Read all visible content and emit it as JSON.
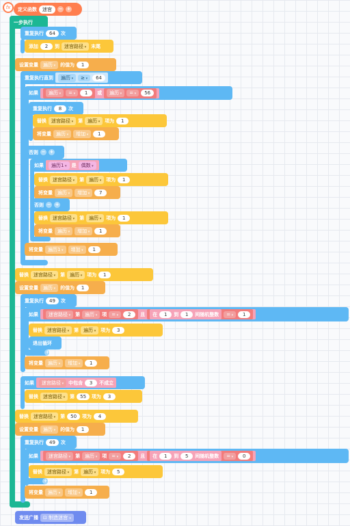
{
  "define": {
    "label": "定义函数",
    "name": "迷宫"
  },
  "step": "一步执行",
  "b1": {
    "label": "重复执行",
    "n": "64",
    "unit": "次"
  },
  "b2": {
    "label": "添加",
    "n": "2",
    "to": "到",
    "list": "迷宫路径",
    "end": "末尾"
  },
  "b3": {
    "label": "设置变量",
    "var": "遍历",
    "assign": "的值为",
    "val": "1"
  },
  "b4": {
    "label": "重复执行直到",
    "var": "遍历",
    "op": "≥",
    "val": "64"
  },
  "b5": {
    "label": "如果",
    "a": "遍历",
    "eq1": "=",
    "v1": "1",
    "or": "或",
    "b": "遍历",
    "eq2": "=",
    "v2": "56"
  },
  "b6": {
    "label": "重复执行",
    "n": "8",
    "unit": "次"
  },
  "b7": {
    "label": "替换",
    "list": "迷宫路径",
    "nth": "第",
    "idx": "遍历",
    "item": "项为",
    "val": "1"
  },
  "b8": {
    "label": "将变量",
    "var": "遍历",
    "inc": "增加",
    "val": "1"
  },
  "b9": {
    "label": "否则"
  },
  "b10": {
    "label": "如果",
    "var": "遍历1",
    "is": "是",
    "kind": "偶数"
  },
  "b11": {
    "label": "替换",
    "list": "迷宫路径",
    "nth": "第",
    "idx": "遍历",
    "item": "项为",
    "val": "1"
  },
  "b12": {
    "label": "将变量",
    "var": "遍历",
    "inc": "增加",
    "val": "7"
  },
  "b13": {
    "label": "否则"
  },
  "b14": {
    "label": "替换",
    "list": "迷宫路径",
    "nth": "第",
    "idx": "遍历",
    "item": "项为",
    "val": "1"
  },
  "b15": {
    "label": "将变量",
    "var": "遍历",
    "inc": "增加",
    "val": "1"
  },
  "b16": {
    "label": "将变量",
    "var": "遍历1",
    "inc": "增加",
    "val": "1"
  },
  "b17": {
    "label": "替换",
    "list": "迷宫路径",
    "nth": "第",
    "idx": "遍历",
    "item": "项为",
    "val": "1"
  },
  "b18": {
    "label": "设置变量",
    "var": "遍历",
    "assign": "的值为",
    "val": "1"
  },
  "b19": {
    "label": "重复执行",
    "n": "49",
    "unit": "次"
  },
  "b20": {
    "label": "如果",
    "list": "迷宫路径",
    "nth": "第",
    "idx": "遍历",
    "item": "项",
    "eq": "=",
    "v": "2",
    "and": "且",
    "in": "在",
    "lo": "1",
    "to": "到",
    "hi": "1",
    "rand": "间随机整数",
    "eq2": "=",
    "v2": "1"
  },
  "b21": {
    "label": "替换",
    "list": "迷宫路径",
    "nth": "第",
    "idx": "遍历",
    "item": "项为",
    "val": "3"
  },
  "b22": {
    "label": "退出循环"
  },
  "b23": {
    "label": "将变量",
    "var": "遍历",
    "inc": "增加",
    "val": "1"
  },
  "b24": {
    "label": "如果",
    "list": "迷宫路径",
    "contains": "中包含",
    "v": "3",
    "neg": "不成立"
  },
  "b25": {
    "label": "替换",
    "list": "迷宫路径",
    "nth": "第",
    "idx": "55",
    "item": "项为",
    "val": "3"
  },
  "b26": {
    "label": "替换",
    "list": "迷宫路径",
    "nth": "第",
    "idx": "50",
    "item": "项为",
    "val": "4"
  },
  "b27": {
    "label": "设置变量",
    "var": "遍历",
    "assign": "的值为",
    "val": "1"
  },
  "b28": {
    "label": "重复执行",
    "n": "49",
    "unit": "次"
  },
  "b29": {
    "label": "如果",
    "list": "迷宫路径",
    "nth": "第",
    "idx": "遍历",
    "item": "项",
    "eq": "=",
    "v": "2",
    "and": "且",
    "in": "在",
    "lo": "1",
    "to": "到",
    "hi": "5",
    "rand": "间随机整数",
    "eq2": "=",
    "v2": "0"
  },
  "b30": {
    "label": "替换",
    "list": "迷宫路径",
    "nth": "第",
    "idx": "遍历",
    "item": "项为",
    "val": "5"
  },
  "b31": {
    "label": "将变量",
    "var": "遍历",
    "inc": "增加",
    "val": "1"
  },
  "b32": {
    "label": "发送广播",
    "msg": "制造迷宫"
  },
  "colors": {
    "define": "#ff7e4f",
    "control": "#1cb794",
    "loop": "#5eb8f4",
    "list": "#fcc73a",
    "variable": "#f6ae4c",
    "broadcast": "#6f8bef"
  }
}
